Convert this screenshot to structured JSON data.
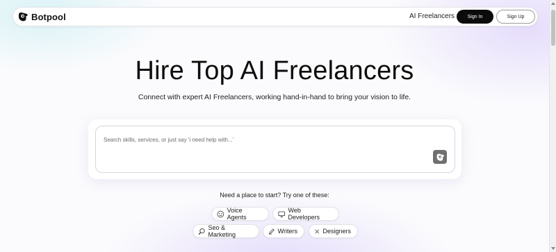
{
  "brand": {
    "name": "Botpool",
    "logo_icon": "botpool-logo-icon"
  },
  "nav": {
    "dropdown_label": "AI Freelancers",
    "signin_label": "Sign In",
    "signup_label": "Sign Up"
  },
  "hero": {
    "title": "Hire Top AI Freelancers",
    "subtitle": "Connect with expert AI Freelancers, working hand-in-hand to bring your vision to life."
  },
  "search": {
    "placeholder": "Search skills, services, or just say 'i need help with...'",
    "value": "",
    "send_icon": "botpool-send-icon"
  },
  "suggestions": {
    "label": "Need a place to start? Try one of these:",
    "chips": [
      {
        "label": "Voice Agents",
        "icon": "voice-agent-icon"
      },
      {
        "label": "Web Developers",
        "icon": "monitor-icon"
      },
      {
        "label": "Seo & Marketing",
        "icon": "magnifier-icon"
      },
      {
        "label": "Writers",
        "icon": "pen-icon"
      },
      {
        "label": "Designers",
        "icon": "design-tools-icon"
      }
    ]
  },
  "colors": {
    "primary_button": "#0b0b0b",
    "send_button": "#6f6f6f",
    "gradient_cyan": "#bfeaf0",
    "gradient_purple": "#d7c8fa"
  }
}
